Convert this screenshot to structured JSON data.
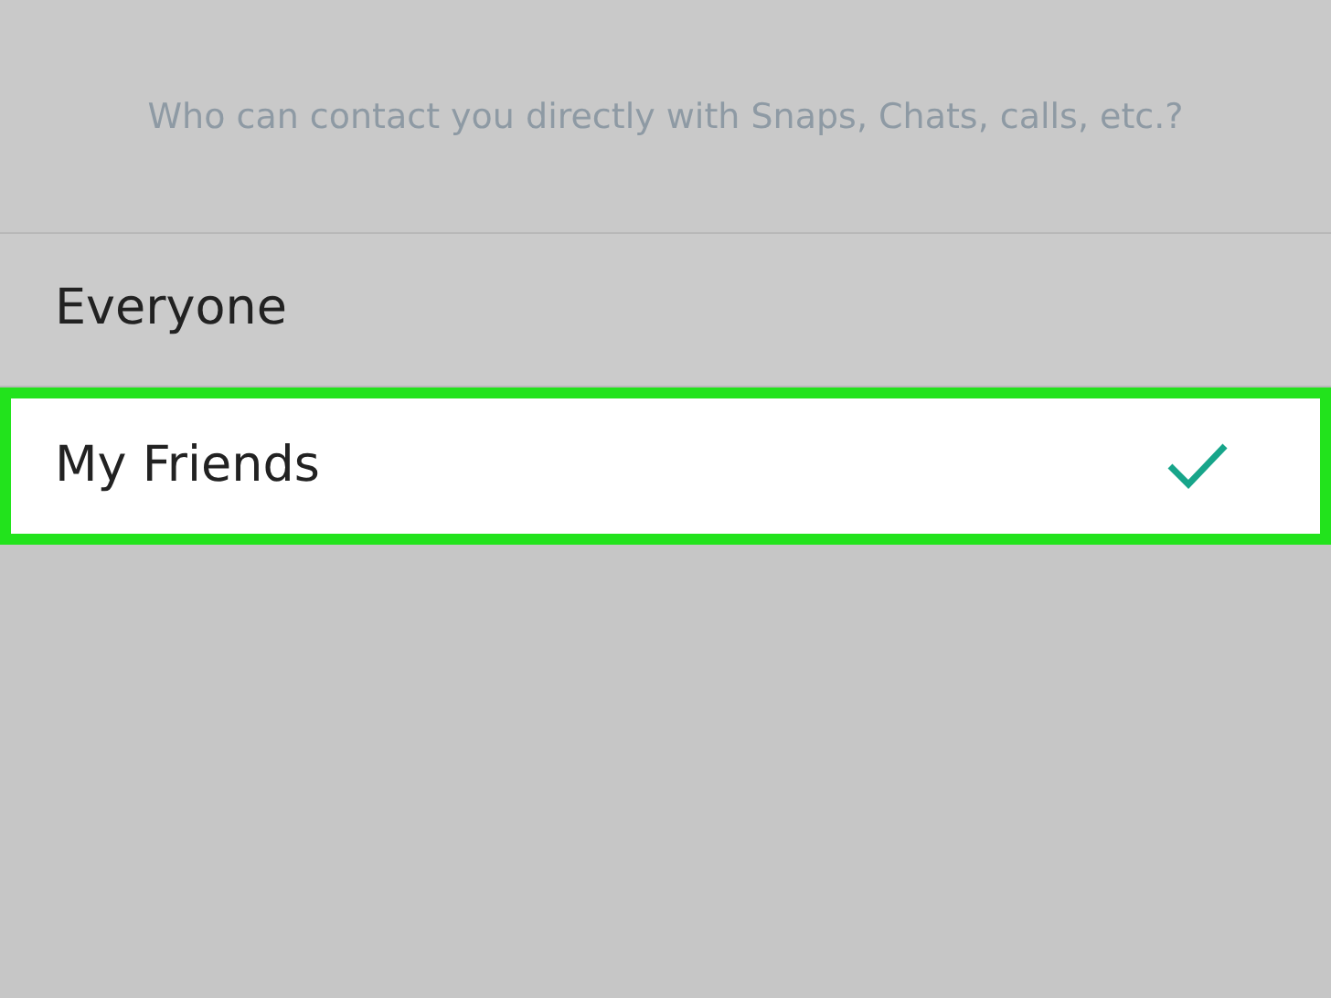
{
  "description": "Who can contact you directly with Snaps, Chats, calls, etc.?",
  "options": [
    {
      "label": "Everyone",
      "selected": false
    },
    {
      "label": "My Friends",
      "selected": true
    }
  ]
}
